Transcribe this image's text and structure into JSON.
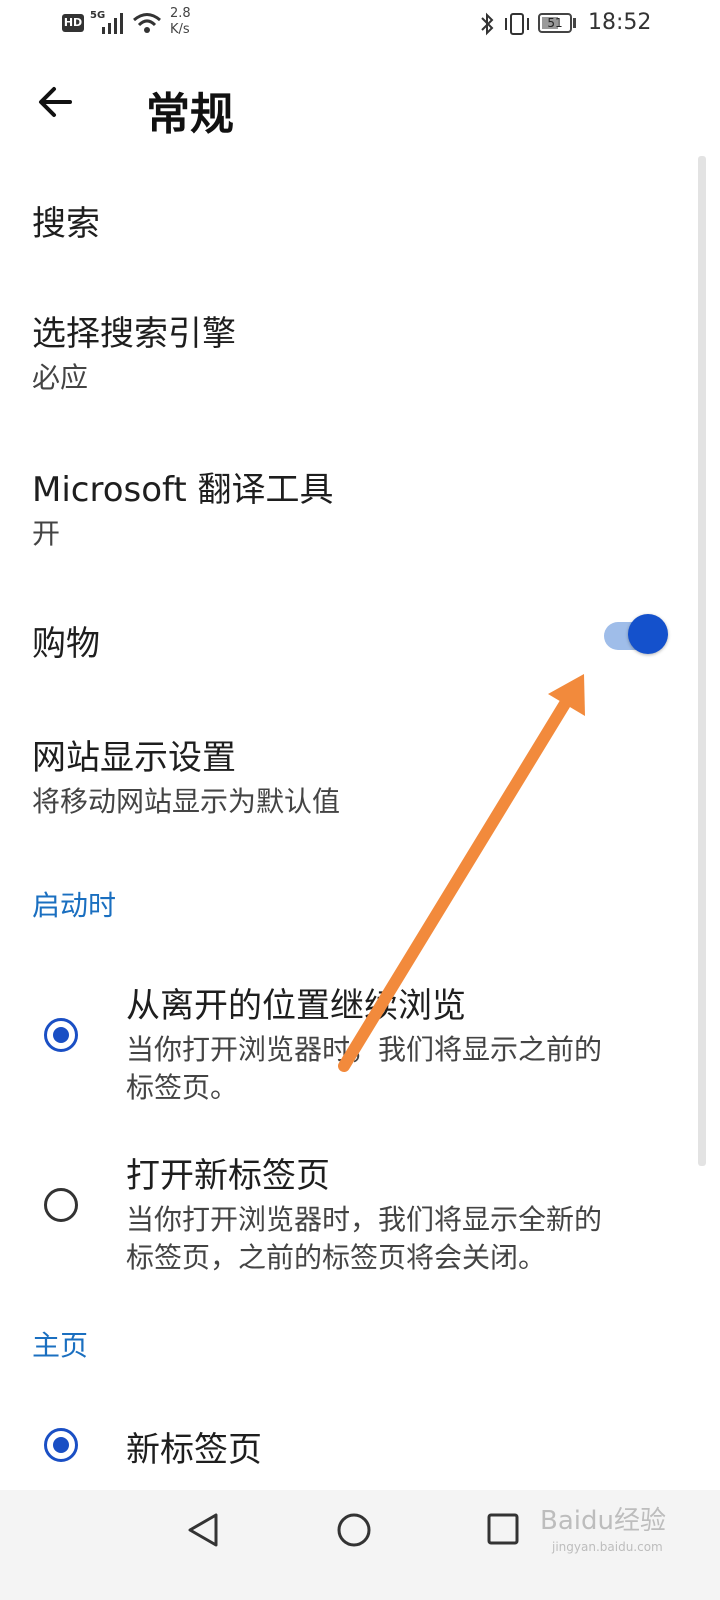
{
  "status_bar": {
    "hd": "HD",
    "network": "5G",
    "speed_value": "2.8",
    "speed_unit": "K/s",
    "battery": "51",
    "time": "18:52"
  },
  "header": {
    "title": "常规",
    "back_icon": "arrow-left-icon"
  },
  "settings": {
    "search_section": "搜索",
    "engine": {
      "title": "选择搜索引擎",
      "value": "必应"
    },
    "translator": {
      "title": "Microsoft 翻译工具",
      "value": "开"
    },
    "shopping": {
      "title": "购物",
      "enabled": true
    },
    "site_display": {
      "title": "网站显示设置",
      "value": "将移动网站显示为默认值"
    }
  },
  "startup": {
    "header": "启动时",
    "options": [
      {
        "title": "从离开的位置继续浏览",
        "desc": "当你打开浏览器时，我们将显示之前的标签页。",
        "desc_line1": "当你打开浏览器时，我们将显示之前的",
        "desc_line2": "标签页。",
        "selected": true
      },
      {
        "title": "打开新标签页",
        "desc": "当你打开浏览器时，我们将显示全新的标签页，之前的标签页将会关闭。",
        "desc_line1": "当你打开浏览器时，我们将显示全新的",
        "desc_line2": "标签页，之前的标签页将会关闭。",
        "selected": false
      }
    ]
  },
  "homepage": {
    "header": "主页",
    "options": [
      {
        "title": "新标签页",
        "selected": true
      }
    ]
  },
  "nav_bar": {
    "back_icon": "triangle-back-icon",
    "home_icon": "circle-home-icon",
    "recents_icon": "square-recents-icon"
  },
  "watermark": {
    "text": "Baidu经验",
    "sub": "jingyan.baidu.com"
  },
  "colors": {
    "accent": "#1a4fc4",
    "section": "#1a6fc0",
    "annotation_arrow": "#f28a3c"
  }
}
